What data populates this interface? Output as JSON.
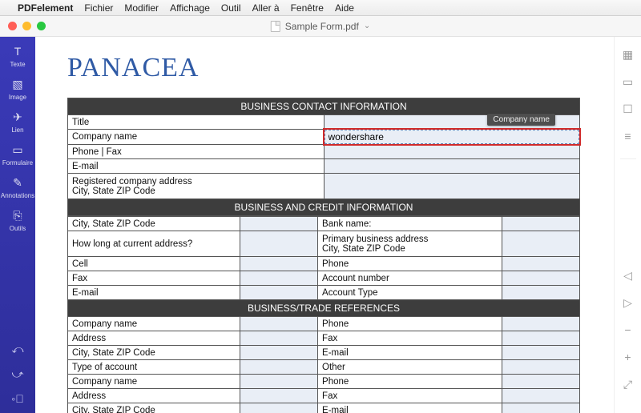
{
  "menubar": {
    "app": "PDFelement",
    "items": [
      "Fichier",
      "Modifier",
      "Affichage",
      "Outil",
      "Aller à",
      "Fenêtre",
      "Aide"
    ]
  },
  "titlebar": {
    "filename": "Sample Form.pdf"
  },
  "leftToolbar": {
    "items": [
      {
        "label": "Texte",
        "icon": "T"
      },
      {
        "label": "Image",
        "icon": "▧"
      },
      {
        "label": "Lien",
        "icon": "✈"
      },
      {
        "label": "Formulaire",
        "icon": "▭"
      },
      {
        "label": "Annotations",
        "icon": "✎"
      },
      {
        "label": "Outils",
        "icon": "⎘"
      }
    ]
  },
  "doc": {
    "brand": "PANACEA",
    "tooltip": "Company name",
    "section1": {
      "title": "BUSINESS CONTACT INFORMATION",
      "rows": {
        "title": "Title",
        "company": "Company name",
        "company_val": "wondershare",
        "phonefax": "Phone | Fax",
        "email": "E-mail",
        "regaddr": "Registered company address\nCity, State ZIP Code"
      }
    },
    "section2": {
      "title": "BUSINESS AND CREDIT INFORMATION",
      "left": [
        "City, State ZIP Code",
        "How long at current address?",
        "Cell",
        "Fax",
        "E-mail"
      ],
      "right": [
        "Bank name:",
        "Primary business address\nCity, State ZIP Code",
        "Phone",
        "Account number",
        "Account Type"
      ]
    },
    "section3": {
      "title": "BUSINESS/TRADE REFERENCES",
      "left": [
        "Company name",
        "Address",
        "City, State ZIP Code",
        "Type of account",
        "Company name",
        "Address",
        "City, State ZIP Code"
      ],
      "right": [
        "Phone",
        "Fax",
        "E-mail",
        "Other",
        "Phone",
        "Fax",
        "E-mail"
      ]
    }
  }
}
